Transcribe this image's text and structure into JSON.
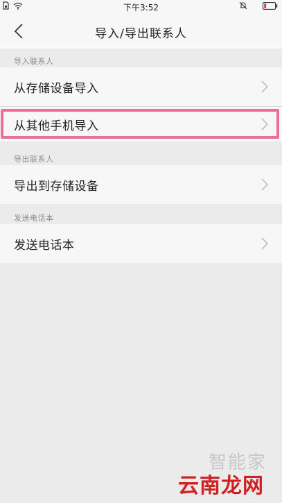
{
  "status_bar": {
    "time": "下午3:52"
  },
  "header": {
    "title": "导入/导出联系人"
  },
  "sections": {
    "import_label": "导入联系人",
    "export_label": "导出联系人",
    "send_label": "发送电话本"
  },
  "items": {
    "import_storage": "从存储设备导入",
    "import_phone": "从其他手机导入",
    "export_storage": "导出到存储设备",
    "send_contacts": "发送电话本"
  },
  "watermark": {
    "line1": "智能家",
    "line2": "云南龙网"
  },
  "colors": {
    "highlight": "#ee6f95",
    "background": "#ebebeb",
    "item_bg": "#f7f7f7"
  }
}
